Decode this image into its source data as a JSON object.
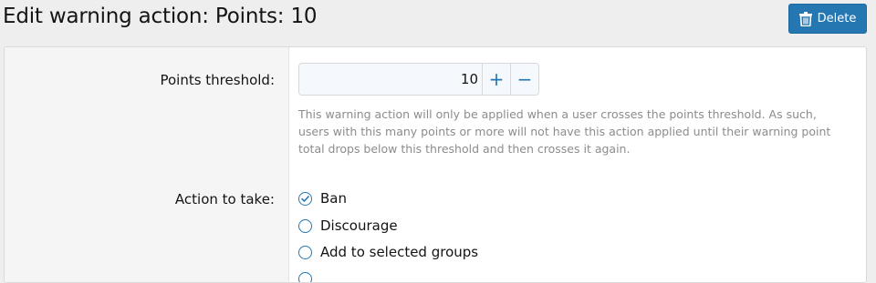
{
  "page": {
    "title": "Edit warning action: Points: 10",
    "delete_label": "Delete"
  },
  "form": {
    "points_threshold": {
      "label": "Points threshold:",
      "value": "10",
      "increment_label": "+",
      "decrement_label": "−",
      "hint": "This warning action will only be applied when a user crosses the points threshold. As such, users with this many points or more will not have this action applied until their warning point total drops below this threshold and then crosses it again."
    },
    "action": {
      "label": "Action to take:",
      "options": [
        {
          "label": "Ban",
          "selected": true
        },
        {
          "label": "Discourage",
          "selected": false
        },
        {
          "label": "Add to selected groups",
          "selected": false
        }
      ]
    }
  },
  "colors": {
    "accent": "#2577b1",
    "background": "#eeeeee",
    "panel": "#ffffff",
    "label_column": "#f5f5f5",
    "hint_text": "#8c8c8c"
  },
  "icons": {
    "delete": "trash-icon",
    "selected_radio": "check-icon"
  }
}
